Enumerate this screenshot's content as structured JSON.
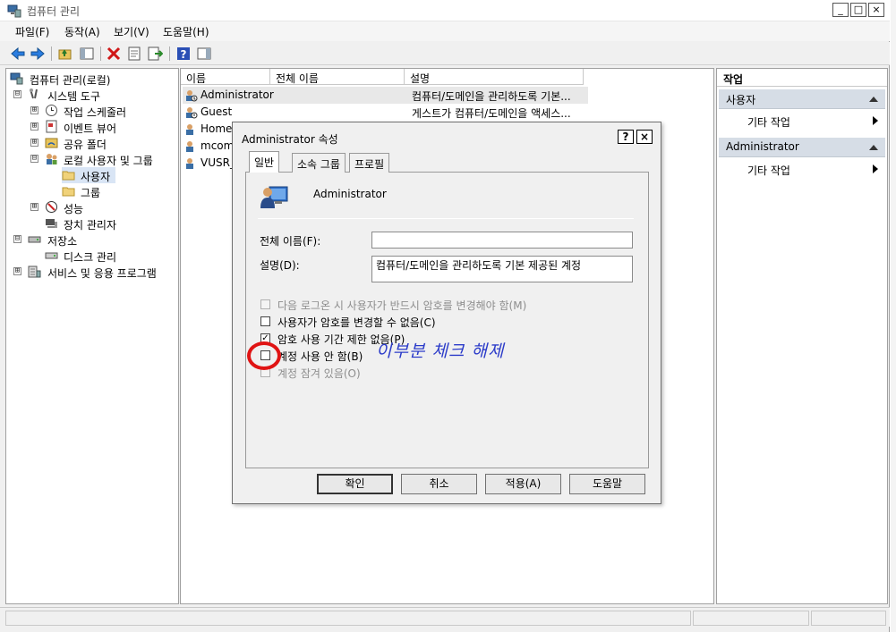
{
  "window": {
    "title": "컴퓨터 관리",
    "controls": {
      "minimize": "_",
      "maximize": "□",
      "close": "×"
    }
  },
  "menu": [
    "파일(F)",
    "동작(A)",
    "보기(V)",
    "도움말(H)"
  ],
  "tree": {
    "root": "컴퓨터 관리(로컬)",
    "items": [
      {
        "label": "시스템 도구",
        "expander": "⊟",
        "icon": "tools-icon"
      },
      {
        "label": "작업 스케줄러",
        "expander": "⊞",
        "icon": "clock-icon"
      },
      {
        "label": "이벤트 뷰어",
        "expander": "⊞",
        "icon": "event-viewer-icon"
      },
      {
        "label": "공유 폴더",
        "expander": "⊞",
        "icon": "shared-folder-icon"
      },
      {
        "label": "로컬 사용자 및 그룹",
        "expander": "⊟",
        "icon": "users-groups-icon"
      },
      {
        "label": "사용자",
        "icon": "folder-icon"
      },
      {
        "label": "그룹",
        "icon": "folder-icon"
      },
      {
        "label": "성능",
        "expander": "⊞",
        "icon": "performance-icon"
      },
      {
        "label": "장치 관리자",
        "icon": "device-manager-icon"
      },
      {
        "label": "저장소",
        "expander": "⊟",
        "icon": "storage-icon"
      },
      {
        "label": "디스크 관리",
        "icon": "disk-icon"
      },
      {
        "label": "서비스 및 응용 프로그램",
        "expander": "⊞",
        "icon": "services-icon"
      }
    ]
  },
  "list": {
    "columns": [
      "이름",
      "전체 이름",
      "설명"
    ],
    "rows": [
      {
        "name": "Administrator",
        "full_name": "",
        "description": "컴퓨터/도메인을 관리하도록 기본..."
      },
      {
        "name": "Guest",
        "full_name": "",
        "description": "게스트가 컴퓨터/도메인을 액세스..."
      },
      {
        "name": "HomeG",
        "full_name": "",
        "description": ""
      },
      {
        "name": "mcom",
        "full_name": "",
        "description": ""
      },
      {
        "name": "VUSR_N",
        "full_name": "",
        "description": ""
      }
    ]
  },
  "actions": {
    "header": "작업",
    "sections": [
      {
        "title": "사용자",
        "item": "기타 작업"
      },
      {
        "title": "Administrator",
        "item": "기타 작업"
      }
    ]
  },
  "dialog": {
    "title": "Administrator 속성",
    "help_button": "?",
    "close_button": "×",
    "tabs": [
      "일반",
      "소속 그룹",
      "프로필"
    ],
    "user_name": "Administrator",
    "full_name_label": "전체 이름(F):",
    "full_name_value": "",
    "description_label": "설명(D):",
    "description_value": "컴퓨터/도메인을 관리하도록 기본 제공된 계정",
    "checkboxes": [
      {
        "label": "다음 로그온 시 사용자가 반드시 암호를 변경해야 함(M)",
        "checked": false,
        "disabled": true
      },
      {
        "label": "사용자가 암호를 변경할 수 없음(C)",
        "checked": false,
        "disabled": false
      },
      {
        "label": "암호 사용 기간 제한 없음(P)",
        "checked": true,
        "disabled": false
      },
      {
        "label": "계정 사용 안 함(B)",
        "checked": false,
        "disabled": false
      },
      {
        "label": "계정 잠겨 있음(O)",
        "checked": false,
        "disabled": true
      }
    ],
    "checkmark": "✓",
    "buttons": [
      "확인",
      "취소",
      "적용(A)",
      "도움말"
    ]
  },
  "annotation": {
    "text": "이부분 체크 해제",
    "color": "#2b3bc9",
    "circle_color": "#e01414"
  }
}
